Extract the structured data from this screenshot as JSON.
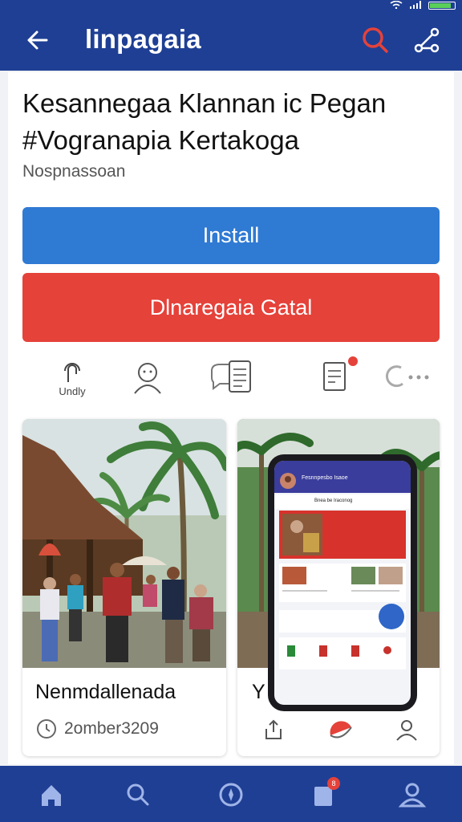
{
  "app_bar": {
    "title": "linpagaia"
  },
  "colors": {
    "primary": "#1f3f94",
    "install_button": "#2f7ad3",
    "secondary_button": "#e5423a"
  },
  "main": {
    "headline_line1": "Kesannegaa Klannan ic Pegan",
    "headline_line2": "#Vogranapia Kertakoga",
    "subtitle": "Nospnassoan",
    "install_label": "Install",
    "secondary_label": "Dlnaregaia Gatal"
  },
  "actions": [
    {
      "icon": "gesture-icon",
      "label": "Undly"
    },
    {
      "icon": "person-icon",
      "label": ""
    },
    {
      "icon": "chat-list-icon",
      "label": ""
    },
    {
      "icon": "document-icon",
      "label": ""
    },
    {
      "icon": "more-chat-icon",
      "label": ""
    }
  ],
  "cards": [
    {
      "title": "Nenmdallenada",
      "meta": "2omber3209",
      "icon": "clock-icon"
    },
    {
      "title": "Y",
      "phone_title": "Fesnnpesbo Isaoe",
      "phone_sub": "Bnea be Iraconog",
      "actions": [
        "share-icon",
        "pie-icon",
        "user-icon"
      ]
    }
  ],
  "bottom_nav": [
    {
      "icon": "home-icon"
    },
    {
      "icon": "search-icon"
    },
    {
      "icon": "compass-icon"
    },
    {
      "icon": "notifications-icon",
      "badge": "8"
    },
    {
      "icon": "profile-icon"
    }
  ]
}
